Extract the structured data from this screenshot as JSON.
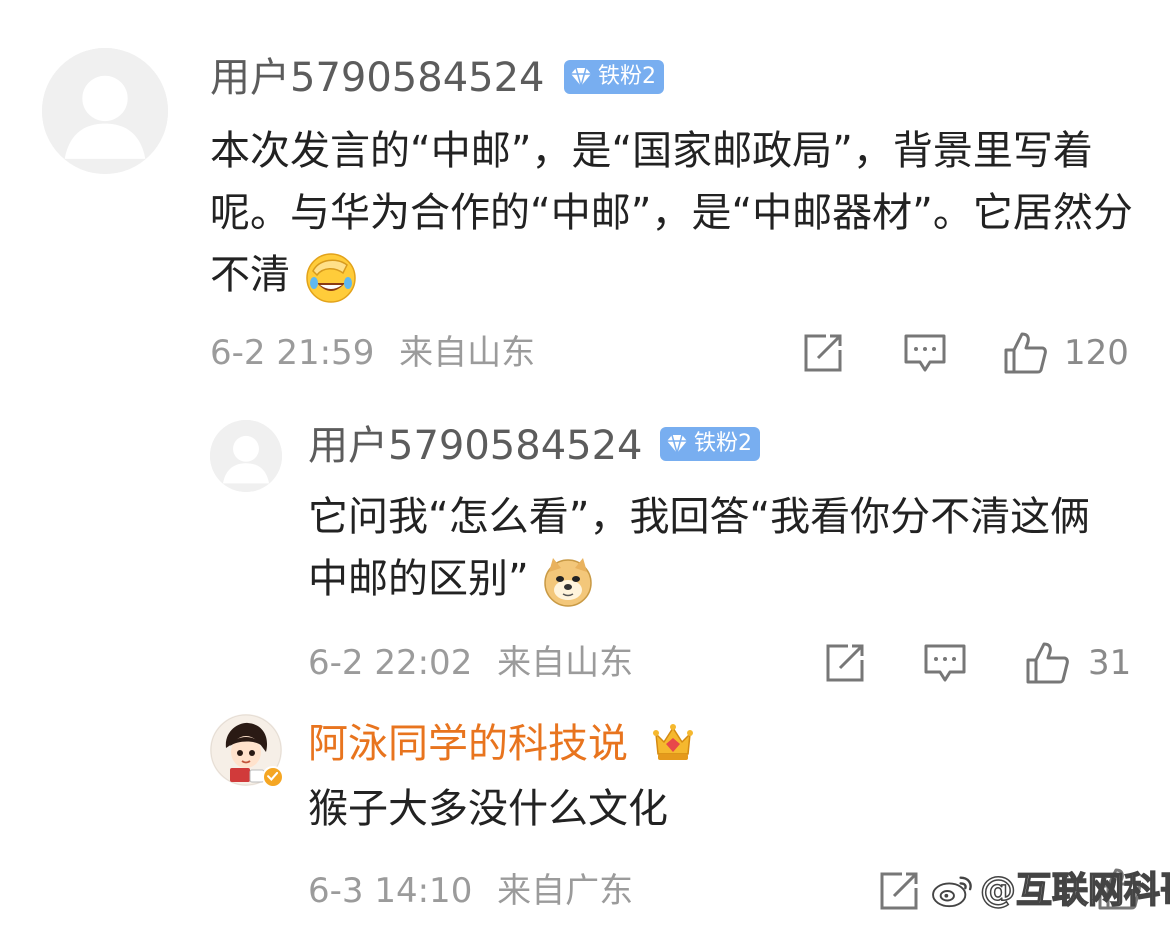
{
  "comments": [
    {
      "username": "用户5790584524",
      "badge": "铁粉2",
      "text": "本次发言的“中邮”，是“国家邮政局”，背景里写着呢。与华为合作的“中邮”，是“中邮器材”。它居然分不清",
      "emoji": "facepalm-laughing-emoji",
      "time": "6-2 21:59",
      "location": "来自山东",
      "likes": "120"
    },
    {
      "username": "用户5790584524",
      "badge": "铁粉2",
      "text": "它问我“怎么看”，我回答“我看你分不清这俩中邮的区别”",
      "emoji": "doge-emoji",
      "time": "6-2 22:02",
      "location": "来自山东",
      "likes": "31"
    },
    {
      "username": "阿泳同学的科技说",
      "badge_icon": "crown-icon",
      "text": "猴子大多没什么文化",
      "time": "6-3 14:10",
      "location": "来自广东",
      "likes": ""
    }
  ],
  "watermark": "@互联网科哥",
  "colors": {
    "badge_bg": "#78aef0",
    "author_name": "#e8741e",
    "meta": "#9b9b9b"
  }
}
